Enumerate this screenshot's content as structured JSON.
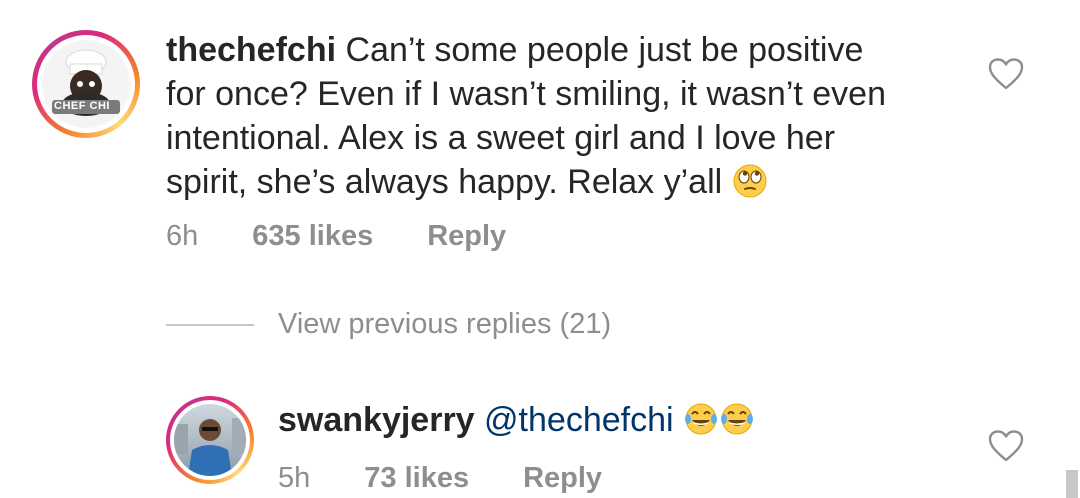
{
  "comment1": {
    "username": "thechefchi",
    "line1": "Can’t some people just be positive",
    "line2": "for once? Even if I wasn’t smiling, it wasn’t even",
    "line3": "intentional. Alex is a sweet girl and I love her",
    "line4": "spirit, she’s always happy. Relax y’all",
    "emoji": "rolling-eyes",
    "time": "6h",
    "likes": "635 likes",
    "reply": "Reply",
    "avatar_label": "CHEF CHI"
  },
  "view_replies": "View previous replies (21)",
  "comment2": {
    "username": "swankyjerry",
    "mention": "@thechefchi",
    "emoji": "tears-of-joy",
    "time": "5h",
    "likes": "73 likes",
    "reply": "Reply"
  },
  "colors": {
    "text": "#262626",
    "muted": "#8e8e8e",
    "mention": "#003569",
    "divider": "#c7c7c7"
  },
  "icons": [
    "heart-outline-icon"
  ]
}
